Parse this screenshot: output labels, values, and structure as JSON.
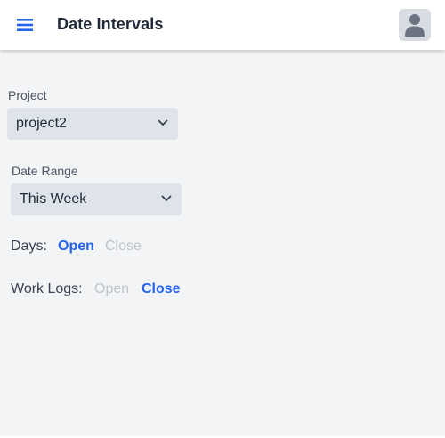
{
  "header": {
    "title": "Date Intervals",
    "menu_icon": "hamburger-menu-icon",
    "avatar_icon": "user-avatar-icon"
  },
  "project": {
    "label": "Project",
    "value": "project2"
  },
  "date_range": {
    "label": "Date Range",
    "value": "This Week"
  },
  "days": {
    "label": "Days:",
    "open": "Open",
    "close": "Close",
    "active": "open"
  },
  "work_logs": {
    "label": "Work Logs:",
    "open": "Open",
    "close": "Close",
    "active": "close"
  },
  "colors": {
    "accent": "#2563eb",
    "inactive": "#c0c4cb",
    "background": "#f3f4f6",
    "select_bg": "#dfe3ea"
  }
}
